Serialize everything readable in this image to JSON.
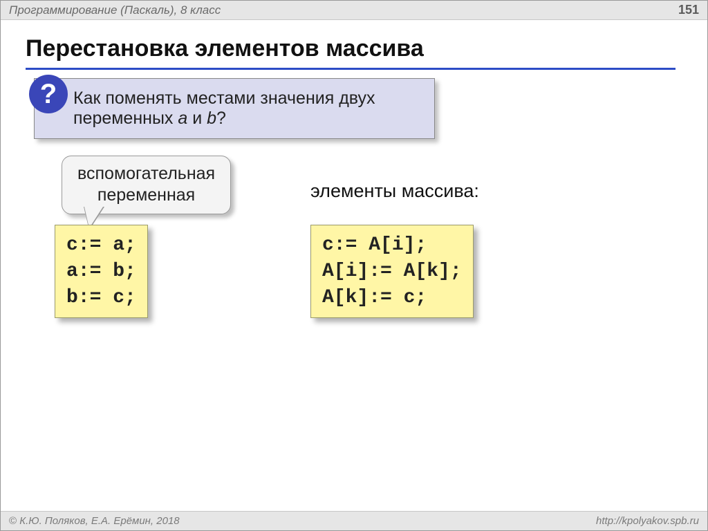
{
  "header": {
    "course": "Программирование (Паскаль), 8 класс",
    "page": "151"
  },
  "title": "Перестановка элементов массива",
  "question": {
    "badge": "?",
    "line1": "Как поменять местами значения двух",
    "line2_prefix": "переменных ",
    "var_a": "a",
    "and": " и ",
    "var_b": "b",
    "line2_suffix": "?"
  },
  "callout": {
    "line1": "вспомогательная",
    "line2": "переменная"
  },
  "array_label": "элементы массива:",
  "code_left": "c:= a;\na:= b;\nb:= c;",
  "code_right": "c:= A[i];\nA[i]:= A[k];\nA[k]:= c;",
  "footer": {
    "copyright_symbol": "©",
    "authors": " К.Ю. Поляков, Е.А. Ерёмин, 2018",
    "url": "http://kpolyakov.spb.ru"
  }
}
